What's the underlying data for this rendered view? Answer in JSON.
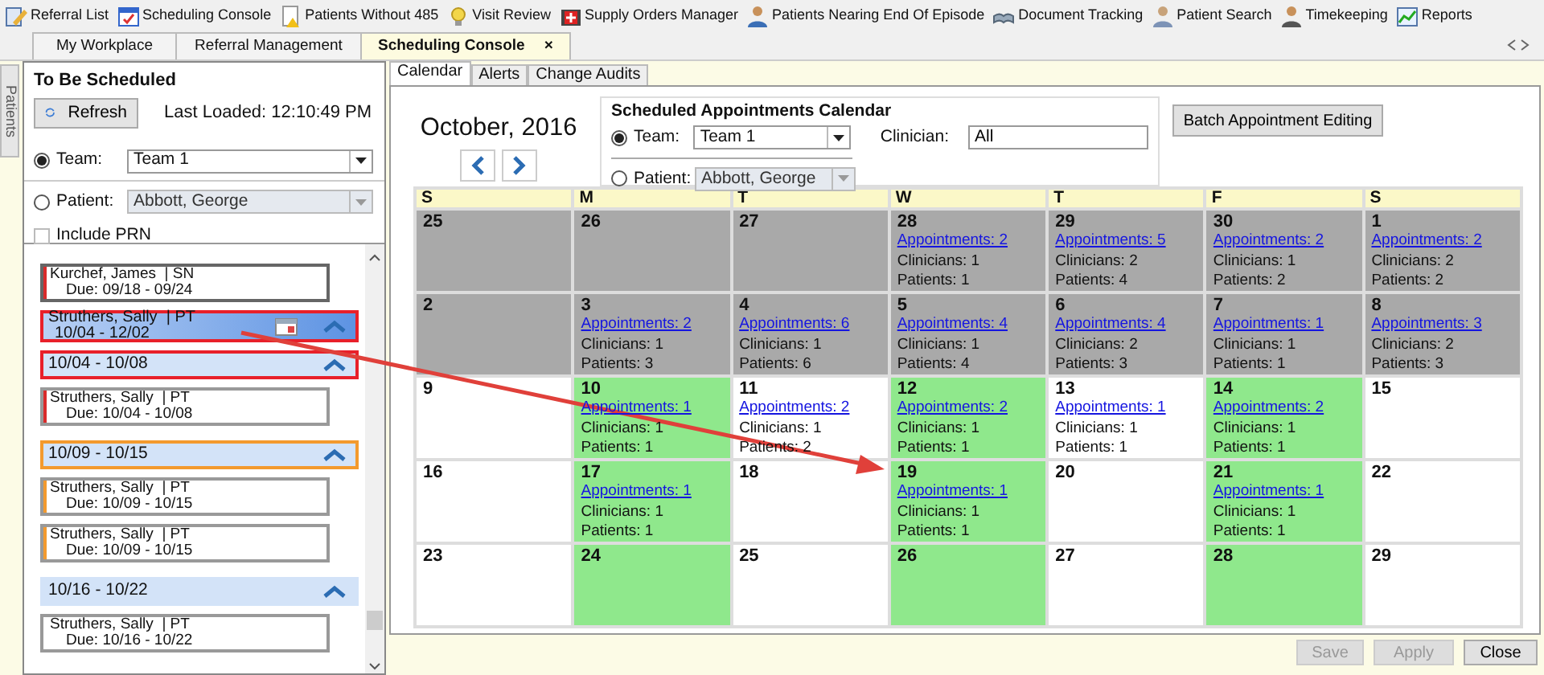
{
  "toolbar": {
    "items": [
      {
        "label": "Referral List"
      },
      {
        "label": "Scheduling Console"
      },
      {
        "label": "Patients Without 485"
      },
      {
        "label": "Visit Review"
      },
      {
        "label": "Supply Orders Manager"
      },
      {
        "label": "Patients Nearing End Of Episode"
      },
      {
        "label": "Document Tracking"
      },
      {
        "label": "Patient Search"
      },
      {
        "label": "Timekeeping"
      },
      {
        "label": "Reports"
      }
    ]
  },
  "doc_tabs": [
    {
      "label": "My Workplace",
      "selected": false
    },
    {
      "label": "Referral Management",
      "selected": false
    },
    {
      "label": "Scheduling Console",
      "selected": true,
      "close": "×"
    }
  ],
  "side_tab": {
    "label": "Patients"
  },
  "to_be_scheduled": {
    "title": "To Be Scheduled",
    "refresh_button": "Refresh",
    "last_loaded": "Last Loaded: 12:10:49 PM",
    "team": {
      "label": "Team:",
      "value": "Team 1",
      "selected": true
    },
    "patient": {
      "label": "Patient:",
      "value": "Abbott, George",
      "selected": false
    },
    "include_prn": {
      "label": "Include PRN",
      "checked": false
    },
    "list": [
      {
        "kind": "card",
        "title": "Kurchef, James  | SN",
        "dates": "Due: 09/18 - 09/24",
        "color": "#d92b2b"
      },
      {
        "kind": "patient",
        "title": "Struthers, Sally  | PT",
        "dates": "10/04 - 12/02",
        "color": "#e8202a"
      },
      {
        "kind": "week",
        "dates": "10/04 - 10/08",
        "color": "#e8202a"
      },
      {
        "kind": "card",
        "title": "Struthers, Sally  | PT",
        "dates": "Due: 10/04 - 10/08",
        "color": "#d92b2b"
      },
      {
        "kind": "week",
        "dates": "10/09 - 10/15",
        "color": "#f39a2e"
      },
      {
        "kind": "card",
        "title": "Struthers, Sally  | PT",
        "dates": "Due: 10/09 - 10/15",
        "color": "#f39a2e"
      },
      {
        "kind": "card",
        "title": "Struthers, Sally  | PT",
        "dates": "Due: 10/09 - 10/15",
        "color": "#f39a2e"
      },
      {
        "kind": "week",
        "dates": "10/16 - 10/22"
      },
      {
        "kind": "card",
        "title": "Struthers, Sally  | PT",
        "dates": "Due: 10/16 - 10/22"
      }
    ]
  },
  "sub_tabs": [
    {
      "label": "Calendar",
      "selected": true
    },
    {
      "label": "Alerts",
      "selected": false
    },
    {
      "label": "Change Audits",
      "selected": false
    }
  ],
  "calendar_header": {
    "month": "October, 2016",
    "group_title": "Scheduled Appointments Calendar",
    "team": {
      "label": "Team:",
      "value": "Team 1",
      "selected": true
    },
    "patient": {
      "label": "Patient:",
      "value": "Abbott, George",
      "selected": false
    },
    "clinician": {
      "label": "Clinician:",
      "value": "All"
    },
    "batch_button": "Batch Appointment Editing"
  },
  "weekdays": [
    "S",
    "M",
    "T",
    "W",
    "T",
    "F",
    "S"
  ],
  "weeks": [
    [
      {
        "day": "25",
        "kind": "past"
      },
      {
        "day": "26",
        "kind": "past"
      },
      {
        "day": "27",
        "kind": "past"
      },
      {
        "day": "28",
        "kind": "past",
        "appointments": "Appointments: 2",
        "clinicians": "Clinicians: 1",
        "patients": "Patients: 1"
      },
      {
        "day": "29",
        "kind": "past",
        "appointments": "Appointments: 5",
        "clinicians": "Clinicians: 2",
        "patients": "Patients: 4"
      },
      {
        "day": "30",
        "kind": "past",
        "appointments": "Appointments: 2",
        "clinicians": "Clinicians: 1",
        "patients": "Patients: 2"
      },
      {
        "day": "1",
        "kind": "past",
        "appointments": "Appointments: 2",
        "clinicians": "Clinicians: 2",
        "patients": "Patients: 2"
      }
    ],
    [
      {
        "day": "2",
        "kind": "past"
      },
      {
        "day": "3",
        "kind": "past",
        "appointments": "Appointments: 2",
        "clinicians": "Clinicians: 1",
        "patients": "Patients: 3"
      },
      {
        "day": "4",
        "kind": "past",
        "appointments": "Appointments: 6",
        "clinicians": "Clinicians: 1",
        "patients": "Patients: 6"
      },
      {
        "day": "5",
        "kind": "past",
        "appointments": "Appointments: 4",
        "clinicians": "Clinicians: 1",
        "patients": "Patients: 4"
      },
      {
        "day": "6",
        "kind": "past",
        "appointments": "Appointments: 4",
        "clinicians": "Clinicians: 2",
        "patients": "Patients: 3"
      },
      {
        "day": "7",
        "kind": "past",
        "appointments": "Appointments: 1",
        "clinicians": "Clinicians: 1",
        "patients": "Patients: 1"
      },
      {
        "day": "8",
        "kind": "past",
        "appointments": "Appointments: 3",
        "clinicians": "Clinicians: 2",
        "patients": "Patients: 3"
      }
    ],
    [
      {
        "day": "9",
        "kind": "open"
      },
      {
        "day": "10",
        "kind": "due",
        "appointments": "Appointments: 1",
        "clinicians": "Clinicians: 1",
        "patients": "Patients: 1"
      },
      {
        "day": "11",
        "kind": "open",
        "appointments": "Appointments: 2",
        "clinicians": "Clinicians: 1",
        "patients": "Patients: 2"
      },
      {
        "day": "12",
        "kind": "due",
        "appointments": "Appointments: 2",
        "clinicians": "Clinicians: 1",
        "patients": "Patients: 1"
      },
      {
        "day": "13",
        "kind": "open",
        "appointments": "Appointments: 1",
        "clinicians": "Clinicians: 1",
        "patients": "Patients: 1"
      },
      {
        "day": "14",
        "kind": "due",
        "appointments": "Appointments: 2",
        "clinicians": "Clinicians: 1",
        "patients": "Patients: 1"
      },
      {
        "day": "15",
        "kind": "open"
      }
    ],
    [
      {
        "day": "16",
        "kind": "open"
      },
      {
        "day": "17",
        "kind": "due",
        "appointments": "Appointments: 1",
        "clinicians": "Clinicians: 1",
        "patients": "Patients: 1"
      },
      {
        "day": "18",
        "kind": "open"
      },
      {
        "day": "19",
        "kind": "due",
        "appointments": "Appointments: 1",
        "clinicians": "Clinicians: 1",
        "patients": "Patients: 1"
      },
      {
        "day": "20",
        "kind": "open"
      },
      {
        "day": "21",
        "kind": "due",
        "appointments": "Appointments: 1",
        "clinicians": "Clinicians: 1",
        "patients": "Patients: 1"
      },
      {
        "day": "22",
        "kind": "open"
      }
    ],
    [
      {
        "day": "23",
        "kind": "open"
      },
      {
        "day": "24",
        "kind": "due"
      },
      {
        "day": "25",
        "kind": "open"
      },
      {
        "day": "26",
        "kind": "due"
      },
      {
        "day": "27",
        "kind": "open"
      },
      {
        "day": "28",
        "kind": "due"
      },
      {
        "day": "29",
        "kind": "open"
      }
    ]
  ],
  "footer_buttons": [
    {
      "label": "Save",
      "disabled": true
    },
    {
      "label": "Apply",
      "disabled": true
    },
    {
      "label": "Close",
      "disabled": false
    }
  ]
}
